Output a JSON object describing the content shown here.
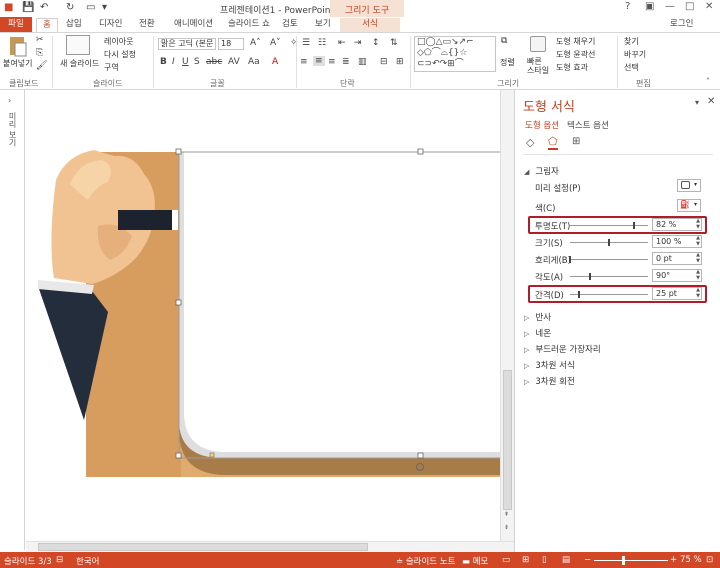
{
  "window": {
    "title": "프레젠테이션1 - PowerPoint",
    "context_tool": "그리기 도구"
  },
  "tabs": {
    "file": "파일",
    "home": "홈",
    "insert": "삽입",
    "design": "디자인",
    "transitions": "전환",
    "animations": "애니메이션",
    "slideshow": "슬라이드 쇼",
    "review": "검토",
    "view": "보기",
    "format": "서식",
    "signin": "로그인"
  },
  "ribbon": {
    "clipboard": {
      "paste": "붙여넣기",
      "label": "클립보드"
    },
    "slides": {
      "new_slide": "새 슬라이드",
      "layout": "레이아웃",
      "reset": "다시 설정",
      "section": "구역",
      "label": "슬라이드"
    },
    "font": {
      "name": "맑은 고딕 (본문",
      "size": "18",
      "label": "글꼴"
    },
    "paragraph": {
      "label": "단락"
    },
    "drawing": {
      "label": "그리기",
      "arrange": "정렬",
      "quick_styles": "빠른\n스타일",
      "fill": "도형 채우기",
      "outline": "도형 윤곽선",
      "effects": "도형 효과"
    },
    "editing": {
      "find": "찾기",
      "replace": "바꾸기",
      "select": "선택",
      "label": "편집"
    }
  },
  "thumb_label": "미리 보기",
  "pane": {
    "title": "도형 서식",
    "tab_shape": "도형 옵션",
    "tab_text": "텍스트 옵션",
    "shadow_section": "그림자",
    "presets_label": "미리 설정(P)",
    "color_label": "색(C)",
    "transparency": {
      "label": "투명도(T)",
      "value": "82 %",
      "fraction": 0.82
    },
    "size": {
      "label": "크기(S)",
      "value": "100 %",
      "fraction": 0.5
    },
    "blur": {
      "label": "흐리게(B)",
      "value": "0 pt",
      "fraction": 0.0
    },
    "angle": {
      "label": "각도(A)",
      "value": "90°",
      "fraction": 0.25
    },
    "distance": {
      "label": "간격(D)",
      "value": "25 pt",
      "fraction": 0.12
    },
    "sections": [
      "반사",
      "네온",
      "부드러운 가장자리",
      "3차원 서식",
      "3차원 회전"
    ]
  },
  "status": {
    "slide": "슬라이드 3/3",
    "lang": "한국어",
    "notes": "슬라이드 노트",
    "comments": "메모",
    "zoom": "75 %"
  },
  "colors": {
    "accent": "#d24726",
    "highlight_box": "#b01c2a",
    "board": "#dfab6f"
  }
}
